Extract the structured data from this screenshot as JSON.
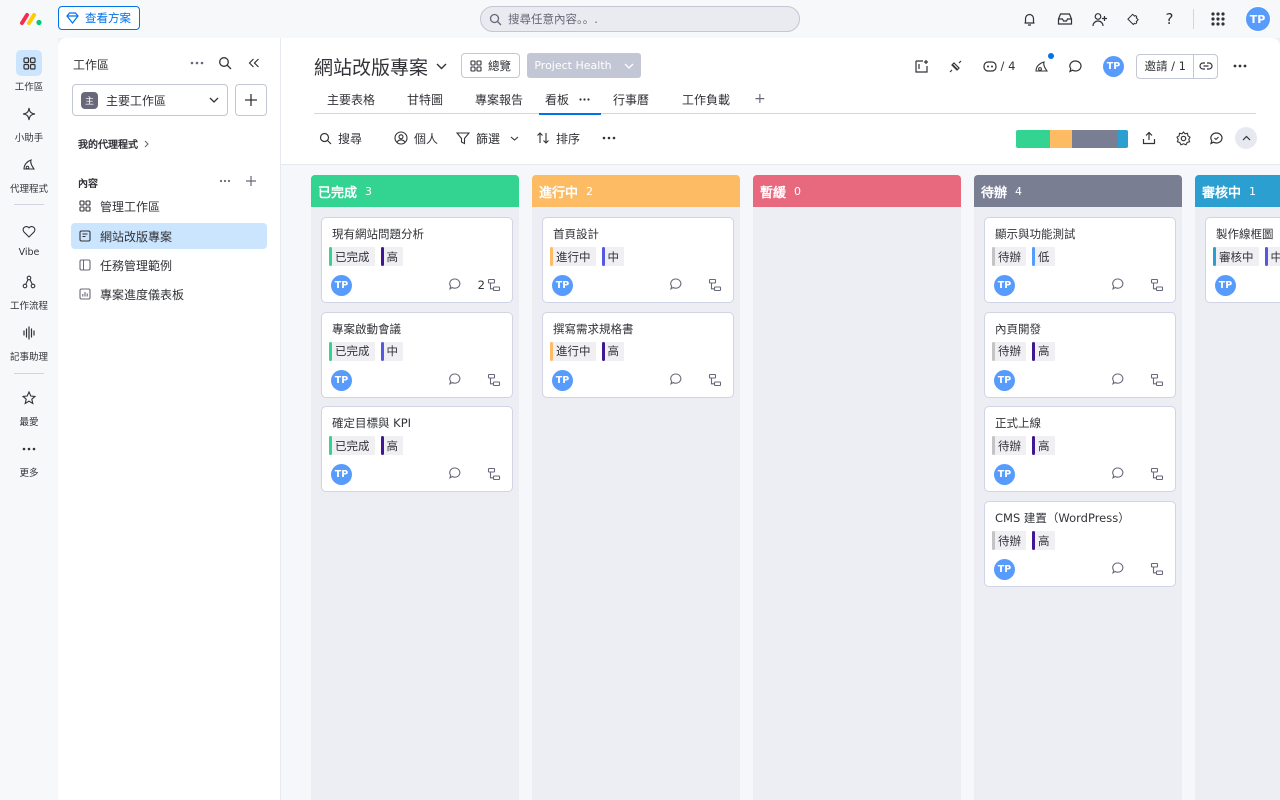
{
  "topbar": {
    "plans_label": "查看方案",
    "search_placeholder": "搜尋任意內容。。.",
    "user_initials": "TP"
  },
  "rail": [
    {
      "label": "工作區",
      "icon": "grid-icon",
      "active": true
    },
    {
      "label": "小助手",
      "icon": "sparkle-icon"
    },
    {
      "label": "代理程式",
      "icon": "agent-icon"
    },
    {
      "label": "Vibe",
      "icon": "heart-icon"
    },
    {
      "label": "工作流程",
      "icon": "workflow-icon"
    },
    {
      "label": "記事助理",
      "icon": "audio-wave-icon"
    },
    {
      "label": "最愛",
      "icon": "star-icon"
    },
    {
      "label": "更多",
      "icon": "more-icon"
    }
  ],
  "sidebar": {
    "title": "工作區",
    "workspace_badge": "主",
    "workspace_name": "主要工作區",
    "agents_label": "我的代理程式",
    "content_label": "內容",
    "items": [
      {
        "label": "管理工作區",
        "icon": "workspace-grid-icon"
      },
      {
        "label": "網站改版專案",
        "icon": "board-icon",
        "active": true
      },
      {
        "label": "任務管理範例",
        "icon": "board-icon"
      },
      {
        "label": "專案進度儀表板",
        "icon": "dashboard-icon"
      }
    ]
  },
  "board": {
    "title": "網站改版專案",
    "overview_label": "總覽",
    "project_health_label": "Project Health",
    "automations_count": "/ 4",
    "invite_label": "邀請 / 1",
    "user_initials": "TP",
    "tabs": [
      "主要表格",
      "甘特圖",
      "專案報告",
      "看板",
      "行事曆",
      "工作負載"
    ],
    "active_tab": "看板"
  },
  "toolbar": {
    "search_label": "搜尋",
    "person_label": "個人",
    "filter_label": "篩選",
    "sort_label": "排序",
    "status_colors": [
      "#33d391",
      "#fdbc64",
      "#797e93",
      "#2b9fd0"
    ]
  },
  "kanban": {
    "columns": [
      {
        "name": "已完成",
        "count": "3",
        "color": "#33d391",
        "tag_color": "#33d391",
        "cards": [
          {
            "title": "現有網站問題分析",
            "status": "已完成",
            "priority": "高",
            "subitems": "2"
          },
          {
            "title": "專案啟動會議",
            "status": "已完成",
            "priority": "中"
          },
          {
            "title": "確定目標與 KPI",
            "status": "已完成",
            "priority": "高"
          }
        ]
      },
      {
        "name": "進行中",
        "count": "2",
        "color": "#fdbc64",
        "tag_color": "#fdbc64",
        "cards": [
          {
            "title": "首頁設計",
            "status": "進行中",
            "priority": "中"
          },
          {
            "title": "撰寫需求規格書",
            "status": "進行中",
            "priority": "高"
          }
        ]
      },
      {
        "name": "暫緩",
        "count": "0",
        "color": "#e8697d",
        "tag_color": "#e8697d",
        "cards": []
      },
      {
        "name": "待辦",
        "count": "4",
        "color": "#797e93",
        "tag_color": "#c4c4c4",
        "cards": [
          {
            "title": "顯示與功能測試",
            "status": "待辦",
            "priority": "低"
          },
          {
            "title": "內頁開發",
            "status": "待辦",
            "priority": "高"
          },
          {
            "title": "正式上線",
            "status": "待辦",
            "priority": "高"
          },
          {
            "title": "CMS 建置（WordPress）",
            "status": "待辦",
            "priority": "高"
          }
        ]
      },
      {
        "name": "審核中",
        "count": "1",
        "color": "#2b9fd0",
        "tag_color": "#2b9fd0",
        "cards": [
          {
            "title": "製作線框圖",
            "status": "審核中",
            "priority": "中"
          }
        ]
      }
    ],
    "priority_colors": {
      "高": "#401694",
      "中": "#5559df",
      "低": "#579bfc"
    },
    "card_user_initials": "TP"
  }
}
